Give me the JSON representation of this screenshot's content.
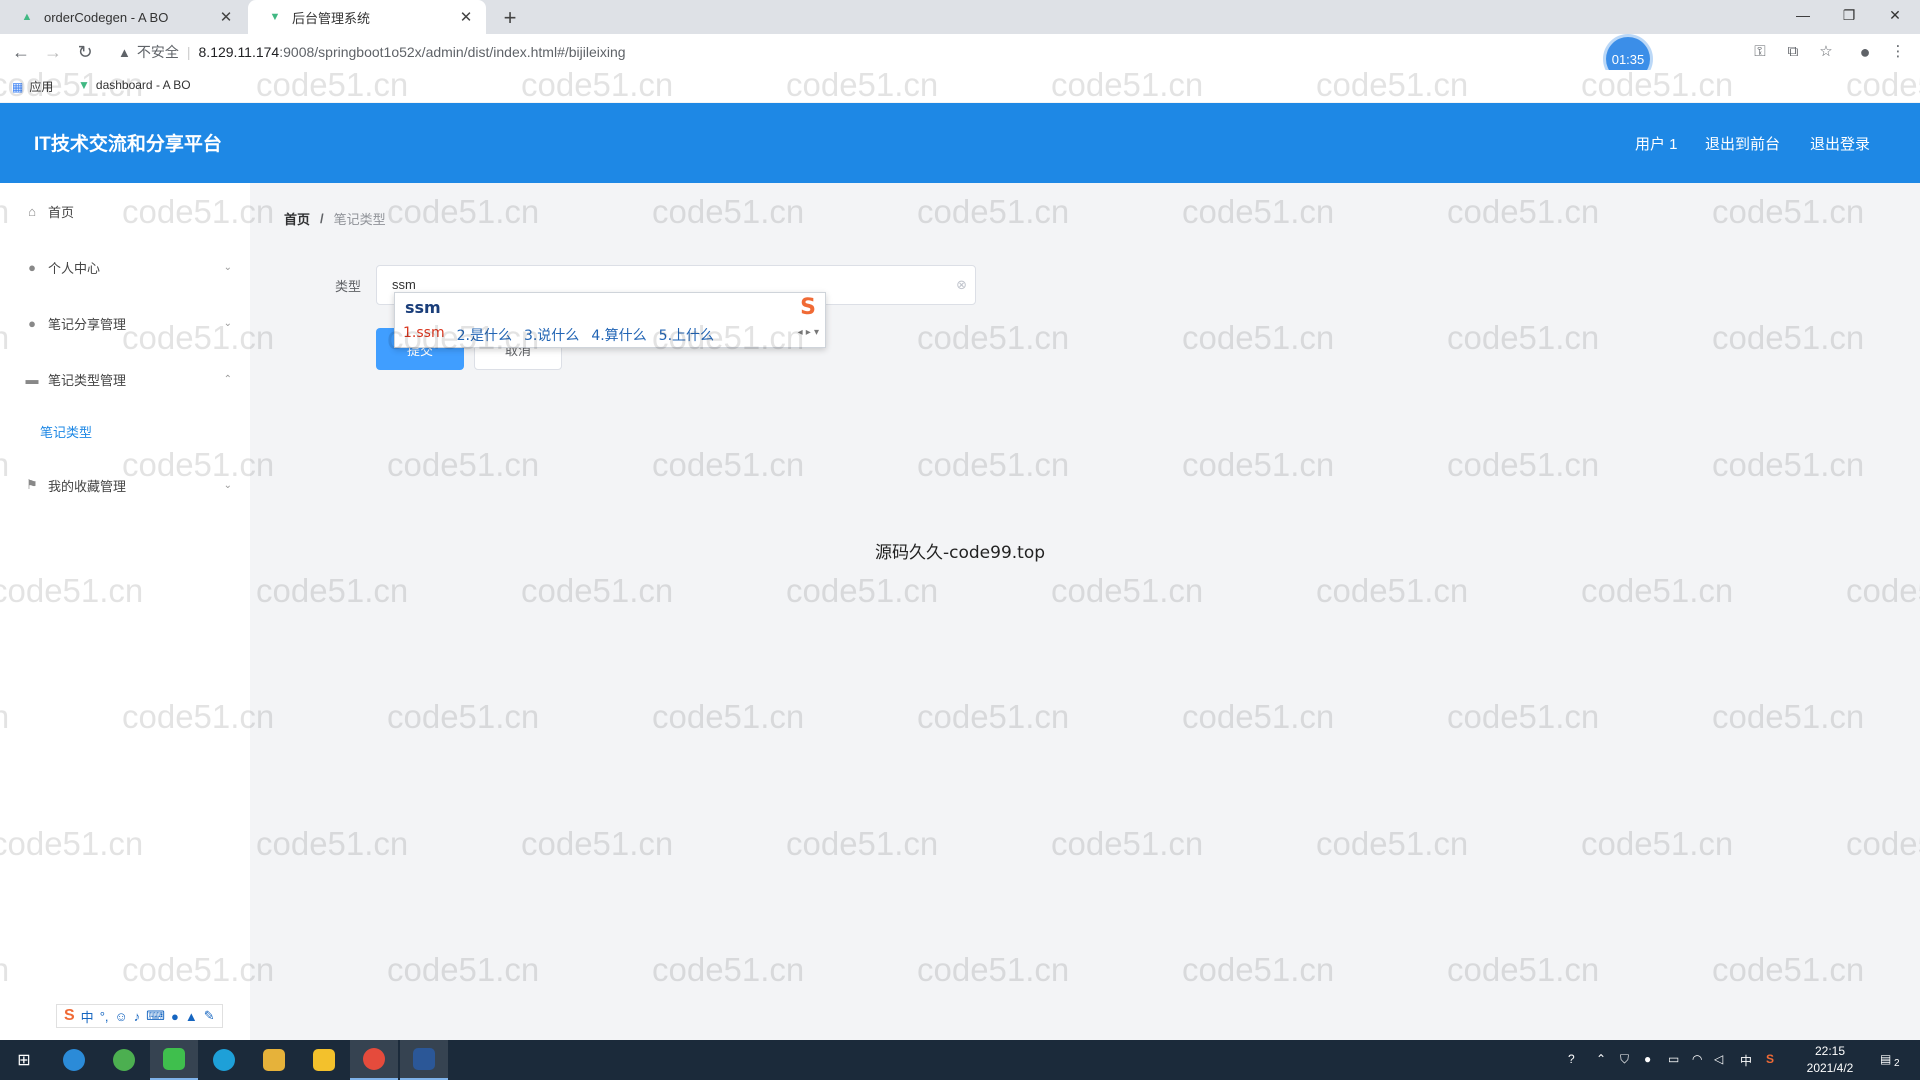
{
  "browser": {
    "tabs": [
      {
        "title": "orderCodegen - A BO",
        "active": false
      },
      {
        "title": "后台管理系统",
        "active": true
      }
    ],
    "address": {
      "insecure_label": "不安全",
      "host": "8.129.11.174",
      "path": ":9008/springboot1o52x/admin/dist/index.html#/bijileixing"
    },
    "timer_badge": "01:35",
    "bookmarks": [
      {
        "label": "应用",
        "icon": "apps-grid-icon"
      },
      {
        "label": "dashboard - A BO",
        "icon": "vue-icon"
      }
    ]
  },
  "app": {
    "brand": "IT技术交流和分享平台",
    "header_links": [
      "用户 1",
      "退出到前台",
      "退出登录"
    ],
    "sidebar": [
      {
        "label": "首页",
        "icon": "home-icon",
        "chevron": ""
      },
      {
        "label": "个人中心",
        "icon": "user-icon",
        "chevron": "down"
      },
      {
        "label": "笔记分享管理",
        "icon": "user-icon",
        "chevron": "down"
      },
      {
        "label": "笔记类型管理",
        "icon": "monitor-icon",
        "chevron": "up"
      },
      {
        "label": "笔记类型",
        "icon": "",
        "chevron": ""
      },
      {
        "label": "我的收藏管理",
        "icon": "flag-icon",
        "chevron": "down"
      }
    ],
    "breadcrumb": {
      "home": "首页",
      "separator": "/",
      "current": "笔记类型"
    },
    "form": {
      "type_label": "类型",
      "type_value": "ssm",
      "submit_label": "提交",
      "cancel_label": "取消"
    },
    "ime_popup": {
      "composition": "ssm",
      "candidates": [
        "1.ssm",
        "2.是什么",
        "3.说什么",
        "4.算什么",
        "5.上什么"
      ]
    },
    "center_text": "源码久久-code99.top",
    "watermark_text": "code51.cn"
  },
  "taskbar": {
    "time": "22:15",
    "date": "2021/4/2",
    "tray_lang": "中",
    "notifications_count": "2"
  },
  "colors": {
    "header_blue": "#1e88e5",
    "primary_button": "#409eff",
    "taskbar": "#1b2a3a"
  }
}
